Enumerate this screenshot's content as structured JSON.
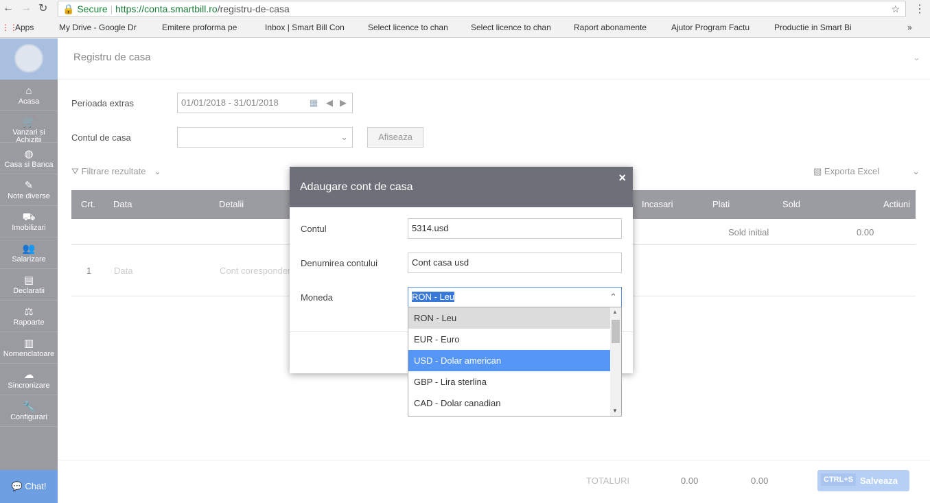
{
  "browser": {
    "secure": "Secure",
    "url_host": "https://conta.smartbill.ro",
    "url_path": "/registru-de-casa",
    "bookmarks": [
      "Apps",
      "My Drive - Google Dr",
      "Emitere proforma pe",
      "Inbox | Smart Bill Con",
      "Select licence to chan",
      "Select licence to chan",
      "Raport abonamente",
      "Ajutor Program Factu",
      "Productie in Smart Bi"
    ],
    "more": "»"
  },
  "sidebar": {
    "items": [
      {
        "label": "Acasa",
        "icon": "⌂"
      },
      {
        "label": "Vanzari si Achizitii",
        "icon": "🛒"
      },
      {
        "label": "Casa si Banca",
        "icon": "◍"
      },
      {
        "label": "Note diverse",
        "icon": "✎"
      },
      {
        "label": "Imobilizari",
        "icon": "⛟"
      },
      {
        "label": "Salarizare",
        "icon": "👥"
      },
      {
        "label": "Declaratii",
        "icon": "▤"
      },
      {
        "label": "Rapoarte",
        "icon": "⚖"
      },
      {
        "label": "Nomenclatoare",
        "icon": "▥"
      },
      {
        "label": "Sincronizare",
        "icon": "☁"
      },
      {
        "label": "Configurari",
        "icon": "🔧"
      }
    ],
    "chat": "💬 Chat!"
  },
  "page": {
    "title": "Registru de casa",
    "period_label": "Perioada extras",
    "period_value": "01/01/2018 - 31/01/2018",
    "account_label": "Contul de casa",
    "show_button": "Afiseaza",
    "filter": "Filtrare rezultate",
    "export": "Exporta Excel",
    "columns": [
      "Crt.",
      "Data",
      "Detalii",
      "Incasari",
      "Plati",
      "Sold",
      "Actiuni"
    ],
    "initial_label": "Sold initial",
    "initial_value": "0.00",
    "row": {
      "crt": "1",
      "data": "Data",
      "details": "Cont corespondent"
    },
    "totals_label": "TOTALURI",
    "total_in": "0.00",
    "total_out": "0.00",
    "save_shortcut": "CTRL+S",
    "save": "Salveaza"
  },
  "modal": {
    "title": "Adaugare cont de casa",
    "close": "×",
    "contul_label": "Contul",
    "contul_value": "5314.usd",
    "denumire_label": "Denumirea contului",
    "denumire_value": "Cont casa usd",
    "moneda_label": "Moneda",
    "moneda_value": "RON - Leu",
    "options": [
      "RON - Leu",
      "EUR - Euro",
      "USD - Dolar american",
      "GBP - Lira sterlina",
      "CAD - Dolar canadian"
    ],
    "hovered_option": "USD - Dolar american"
  }
}
